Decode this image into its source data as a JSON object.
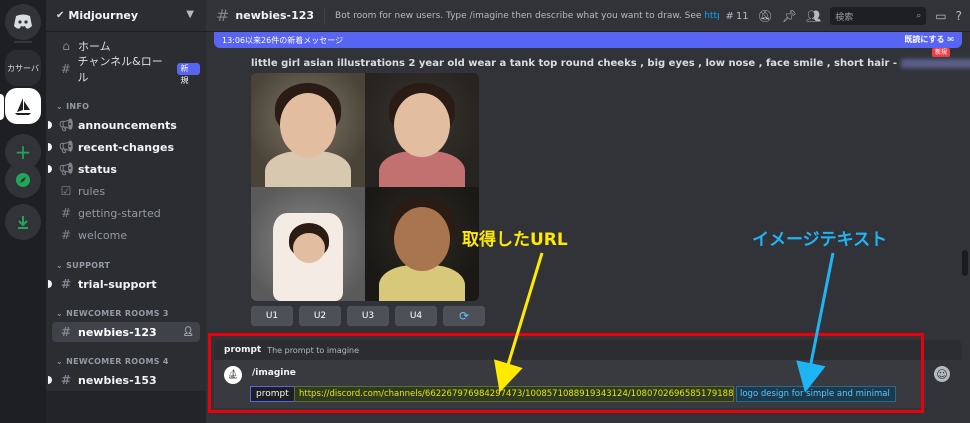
{
  "rail": {
    "server_text": "カサーバ"
  },
  "sidebar": {
    "guild_name": "Midjourney",
    "home_label": "ホーム",
    "channels_roles_label": "チャンネル&ロール",
    "new_badge": "新規",
    "categories": {
      "info": "INFO",
      "support": "SUPPORT",
      "newcomer3": "NEWCOMER ROOMS 3",
      "newcomer4": "NEWCOMER ROOMS 4"
    },
    "channels": {
      "announcements": "announcements",
      "recent_changes": "recent-changes",
      "status": "status",
      "rules": "rules",
      "getting_started": "getting-started",
      "welcome": "welcome",
      "trial_support": "trial-support",
      "newbies_123": "newbies-123",
      "newbies_153": "newbies-153"
    }
  },
  "topbar": {
    "channel_name": "newbies-123",
    "topic_text": "Bot room for new users. Type /imagine then describe what you want to draw. See ",
    "topic_link": "https://docs....",
    "threads_count": "11",
    "search_placeholder": "検索"
  },
  "new_messages": {
    "text": "13:06以来26件の新着メッセージ",
    "mark_read": "既読にする",
    "new_tag": "新規"
  },
  "message": {
    "prompt_text": "little girl asian illustrations 2 year old wear a tank top round cheeks , big eyes , low nose , face smile , short hair -",
    "buttons": [
      "U1",
      "U2",
      "U3",
      "U4"
    ]
  },
  "composer": {
    "hint_name": "prompt",
    "hint_desc": "The prompt to imagine",
    "command": "/imagine",
    "option_label": "prompt",
    "url_value": "https://discord.com/channels/662267976984297473/1008571088919343124/1080702696585179188",
    "text_value": "logo design for simple and minimal"
  },
  "annotations": {
    "url_label": "取得したURL",
    "text_label": "イメージテキスト",
    "url_color": "#ffea00",
    "text_color": "#1fb5f5",
    "box_color": "#e8000b"
  }
}
